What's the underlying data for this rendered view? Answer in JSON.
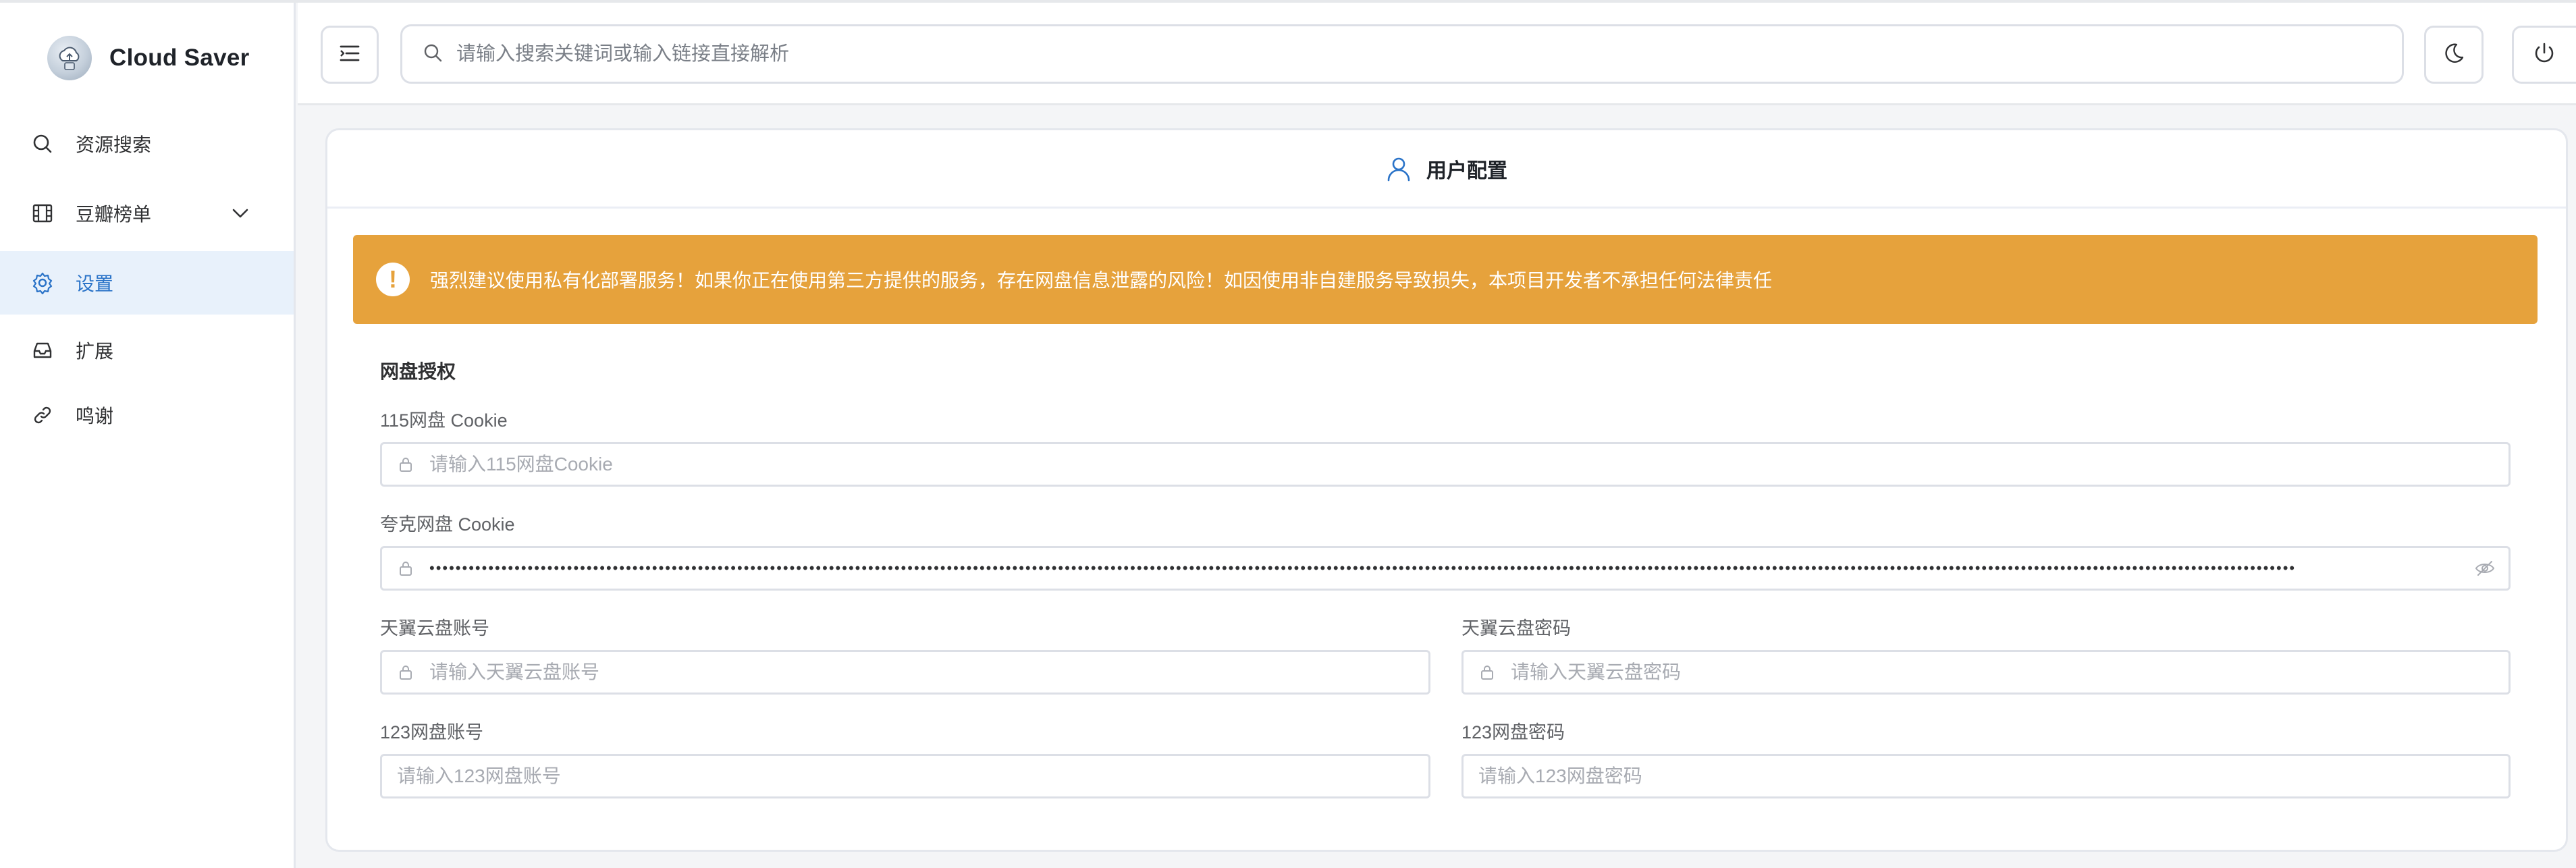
{
  "sidebar": {
    "brand": "Cloud Saver",
    "items": [
      {
        "label": "资源搜索",
        "icon": "search-icon"
      },
      {
        "label": "豆瓣榜单",
        "icon": "film-icon"
      },
      {
        "label": "设置",
        "icon": "gear-icon",
        "active": true
      },
      {
        "label": "扩展",
        "icon": "inbox-icon"
      },
      {
        "label": "鸣谢",
        "icon": "link-icon"
      }
    ]
  },
  "header": {
    "search_placeholder": "请输入搜索关键词或输入链接直接解析"
  },
  "card": {
    "title": "用户配置",
    "alert": "强烈建议使用私有化部署服务！如果你正在使用第三方提供的服务，存在网盘信息泄露的风险！如因使用非自建服务导致损失，本项目开发者不承担任何法律责任",
    "section_title": "网盘授权",
    "fields": {
      "cookie115": {
        "label": "115网盘 Cookie",
        "placeholder": "请输入115网盘Cookie"
      },
      "quark": {
        "label": "夸克网盘 Cookie",
        "value_masked": "•••••••••••••••••••••••••••••••••••••••••••••••••••••••••••••••••••••••••••••••••••••••••••••••••••••••••••••••••••••••••••••••••••••••••••••••••••••••••••••••••••••••••••••••••••••••••••••••••••••••••••••••••••••••••••••••••••••••••••••••••••••••••••••••••••••••••••••••••••••••••••••"
      },
      "tianyi_account": {
        "label": "天翼云盘账号",
        "placeholder": "请输入天翼云盘账号"
      },
      "tianyi_password": {
        "label": "天翼云盘密码",
        "placeholder": "请输入天翼云盘密码"
      },
      "pan123_account": {
        "label": "123网盘账号",
        "placeholder": "请输入123网盘账号"
      },
      "pan123_password": {
        "label": "123网盘密码",
        "placeholder": "请输入123网盘密码"
      }
    }
  },
  "colors": {
    "accent": "#2a73c8",
    "warning": "#e6a23c",
    "active_bg": "#e8f1fb"
  }
}
